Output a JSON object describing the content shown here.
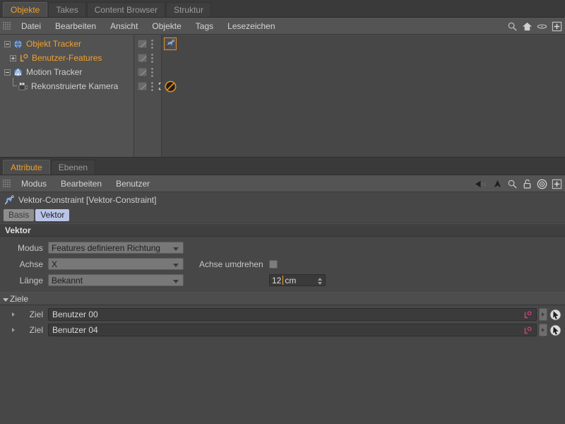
{
  "object_manager": {
    "tabs": [
      {
        "label": "Objekte",
        "active": true
      },
      {
        "label": "Takes",
        "active": false
      },
      {
        "label": "Content Browser",
        "active": false
      },
      {
        "label": "Struktur",
        "active": false
      }
    ],
    "menu": [
      "Datei",
      "Bearbeiten",
      "Ansicht",
      "Objekte",
      "Tags",
      "Lesezeichen"
    ],
    "menu_icons": [
      "search-icon",
      "home-icon",
      "link-icon",
      "add-box-icon"
    ],
    "tree": [
      {
        "label": "Objekt Tracker",
        "icon": "sphere-tracker-icon",
        "selected": true,
        "depth": 0,
        "expander": "minus",
        "tag": "pin-tag-icon",
        "tag_selected": true,
        "extra_icon": null
      },
      {
        "label": "Benutzer-Features",
        "icon": "l-zero-icon",
        "selected": true,
        "depth": 1,
        "expander": "plus",
        "tag": null,
        "tag_selected": false,
        "extra_icon": null
      },
      {
        "label": "Motion Tracker",
        "icon": "motion-tracker-icon",
        "selected": false,
        "depth": 0,
        "expander": "minus",
        "tag": null,
        "tag_selected": false,
        "extra_icon": null
      },
      {
        "label": "Rekonstruierte Kamera",
        "icon": "camera-icon",
        "selected": false,
        "depth": 1,
        "expander": "none",
        "tag": null,
        "tag_selected": false,
        "extra_icon": "no-render-icon"
      }
    ]
  },
  "attribute_manager": {
    "tabs": [
      {
        "label": "Attribute",
        "active": true
      },
      {
        "label": "Ebenen",
        "active": false
      }
    ],
    "menu": [
      "Modus",
      "Bearbeiten",
      "Benutzer"
    ],
    "menu_icons": [
      "back-arrow-icon",
      "up-arrow-icon",
      "search-icon",
      "unlock-icon",
      "target-icon",
      "add-box-icon"
    ],
    "object_title": "Vektor-Constraint [Vektor-Constraint]",
    "object_icon": "pin-icon",
    "subtabs": [
      {
        "label": "Basis",
        "active": false
      },
      {
        "label": "Vektor",
        "active": true
      }
    ],
    "group_vektor": {
      "title": "Vektor",
      "fields": {
        "modus_label": "Modus",
        "modus_value": "Features definieren Richtung",
        "achse_label": "Achse",
        "achse_value": "X",
        "laenge_label": "Länge",
        "laenge_value": "Bekannt",
        "achse_umdrehen_label": "Achse umdrehen",
        "achse_umdrehen_checked": false,
        "length_number": "12",
        "length_unit": "cm"
      }
    },
    "group_ziele": {
      "title": "Ziele",
      "expanded": true,
      "rows": [
        {
          "label": "Ziel",
          "value": "Benutzer 00",
          "badge": "l-zero-icon",
          "picker": "cursor-pick-icon"
        },
        {
          "label": "Ziel",
          "value": "Benutzer 04",
          "badge": "l-zero-icon",
          "picker": "cursor-pick-icon"
        }
      ]
    }
  },
  "colors": {
    "accent_orange": "#f0a030",
    "selected_tab_blue": "#b9c4e8",
    "panel_bg": "#474747",
    "menu_bg": "#545454",
    "tree_bg": "#525252",
    "badge_magenta": "#d83f87"
  }
}
